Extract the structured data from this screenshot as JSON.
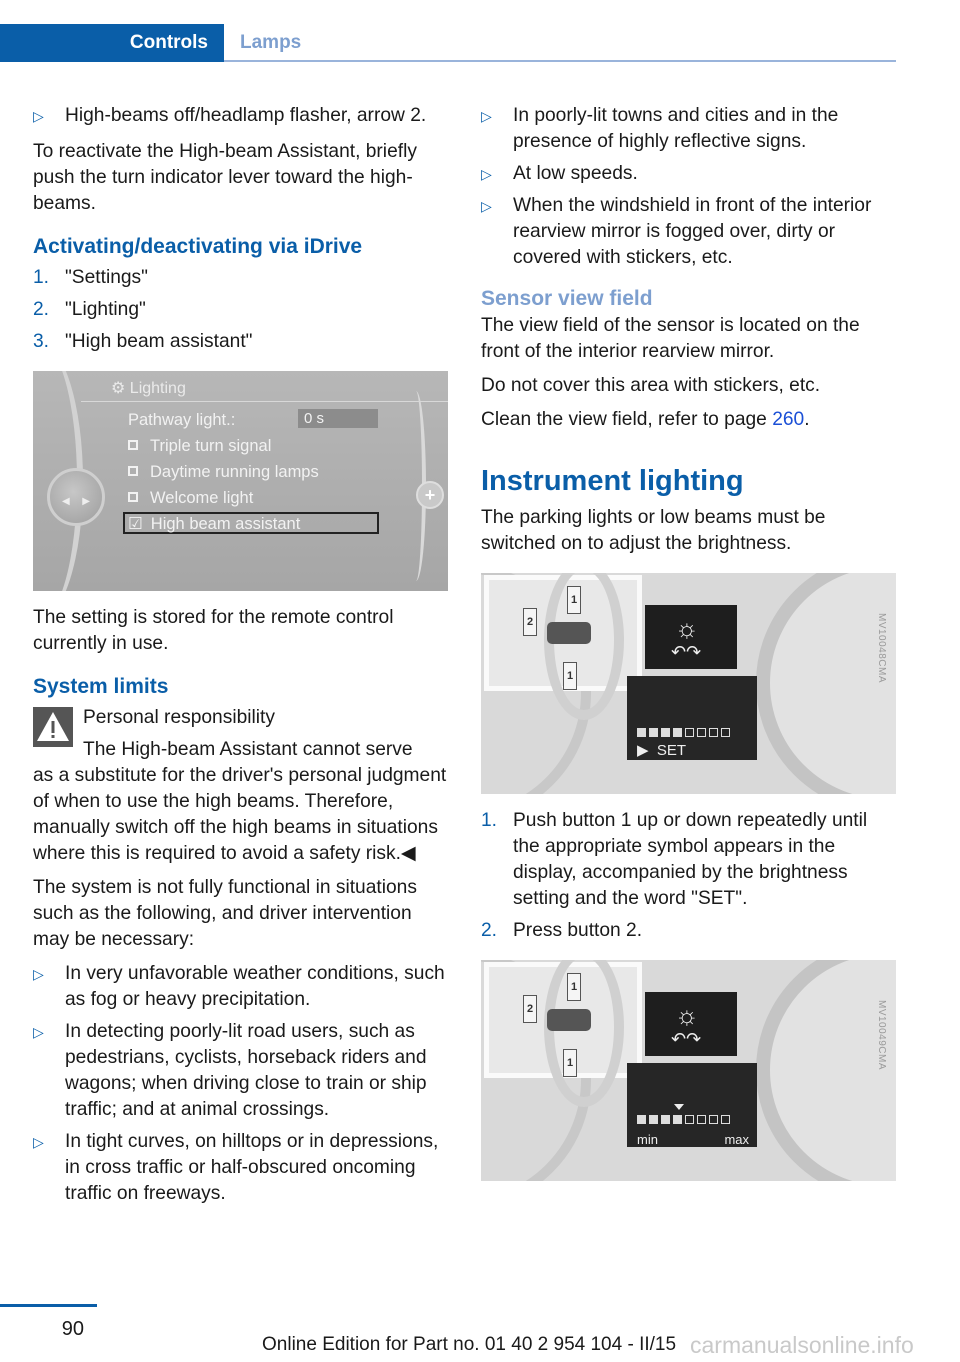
{
  "header": {
    "active_tab": "Controls",
    "inactive_tab": "Lamps"
  },
  "left": {
    "bullet_top": "High-beams off/headlamp flasher, arrow 2.",
    "reactivate_text": "To reactivate the High-beam Assistant, briefly push the turn indicator lever toward the high-beams.",
    "idrive_heading": "Activating/deactivating via iDrive",
    "steps": [
      {
        "num": "1.",
        "text": "\"Settings\""
      },
      {
        "num": "2.",
        "text": "\"Lighting\""
      },
      {
        "num": "3.",
        "text": "\"High beam assistant\""
      }
    ],
    "idrive_screen": {
      "title": "Lighting",
      "pathway_label": "Pathway light.:",
      "pathway_value": "0 s",
      "options": [
        {
          "label": "Triple turn signal",
          "checked": false
        },
        {
          "label": "Daytime running lamps",
          "checked": false
        },
        {
          "label": "Welcome light",
          "checked": false
        },
        {
          "label": "High beam assistant",
          "checked": true
        }
      ],
      "knob_left": "◀",
      "knob_right": "▶",
      "plus": "+"
    },
    "stored_text": "The setting is stored for the remote control currently in use.",
    "limits_heading": "System limits",
    "warning_title": "Personal responsibility",
    "warning_first": "The High-beam Assistant cannot serve",
    "warning_rest": "as a substitute for the driver's personal judgment of when to use the high beams. Therefore, manually switch off the high beams in situations where this is required to avoid a safety risk.◀",
    "system_text": "The system is not fully functional in situations such as the following, and driver intervention may be necessary:",
    "limits": [
      "In very unfavorable weather conditions, such as fog or heavy precipitation.",
      "In detecting poorly-lit road users, such as pedestrians, cyclists, horseback riders and wagons; when driving close to train or ship traffic; and at animal crossings.",
      "In tight curves, on hilltops or in depressions, in cross traffic or half-obscured oncoming traffic on freeways."
    ]
  },
  "right": {
    "limits_cont": [
      "In poorly-lit towns and cities and in the presence of highly reflective signs.",
      "At low speeds.",
      "When the windshield in front of the interior rearview mirror is fogged over, dirty or covered with stickers, etc."
    ],
    "sensor_heading": "Sensor view field",
    "sensor_text": "The view field of the sensor is located on the front of the interior rearview mirror.",
    "cover_text": "Do not cover this area with stickers, etc.",
    "clean_text": "Clean the view field, refer to page ",
    "clean_page": "260",
    "clean_end": ".",
    "instrument_heading": "Instrument lighting",
    "instrument_text": "The parking lights or low beams must be switched on to adjust the brightness.",
    "figure1": {
      "set_label": "SET",
      "arrow_up": "1",
      "arrow_down": "1",
      "arrow_push": "2",
      "code": "MV10048CMA",
      "level": 4,
      "segments": 8
    },
    "steps": [
      {
        "num": "1.",
        "text": "Push button 1 up or down repeatedly until the appropriate symbol appears in the display, accompanied by the brightness setting and the word \"SET\"."
      },
      {
        "num": "2.",
        "text": "Press button 2."
      }
    ],
    "figure2": {
      "min_label": "min",
      "max_label": "max",
      "arrow_up": "1",
      "arrow_down": "1",
      "arrow_push": "2",
      "code": "MV10049CMA",
      "level": 4,
      "segments": 8
    }
  },
  "footer": {
    "page_number": "90",
    "edition": "Online Edition for Part no. 01 40 2 954 104 - II/15",
    "watermark": "carmanualsonline.info"
  },
  "colors": {
    "brand_blue": "#0a5ea8",
    "light_blue": "#7d9fcf",
    "link_blue": "#1a4fd6"
  }
}
